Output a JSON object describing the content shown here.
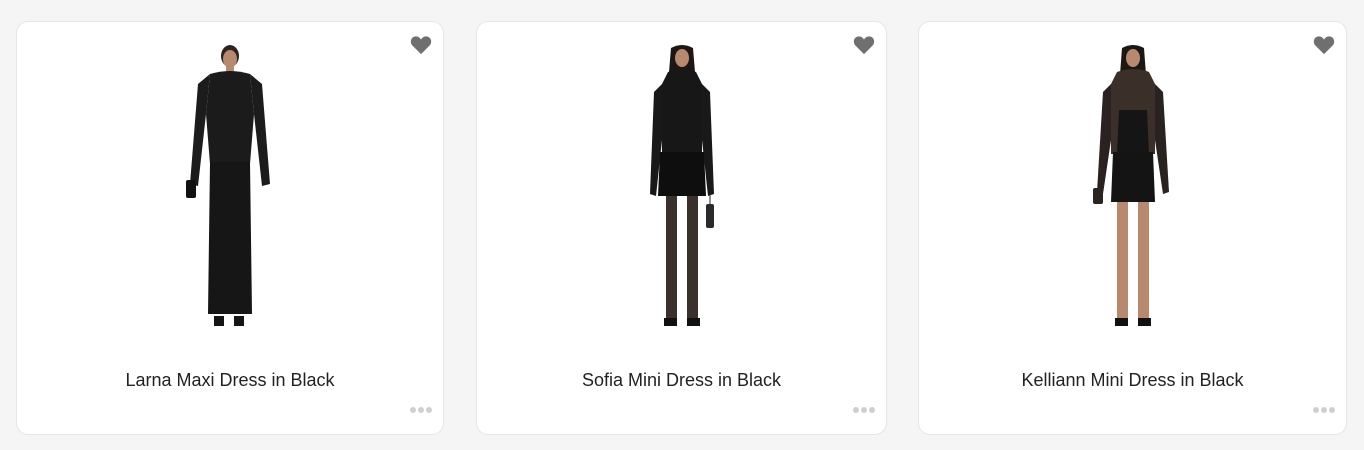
{
  "colors": {
    "heart": "#6f6f6f",
    "dots": "#cfcfcf",
    "dress": "#161616",
    "skin": "#b78a70"
  },
  "products": [
    {
      "title": "Larna Maxi Dress in Black",
      "favorite_icon": "heart-icon",
      "more_icon": "more-horizontal-icon"
    },
    {
      "title": "Sofia Mini Dress in Black",
      "favorite_icon": "heart-icon",
      "more_icon": "more-horizontal-icon"
    },
    {
      "title": "Kelliann Mini Dress in Black",
      "favorite_icon": "heart-icon",
      "more_icon": "more-horizontal-icon"
    }
  ]
}
